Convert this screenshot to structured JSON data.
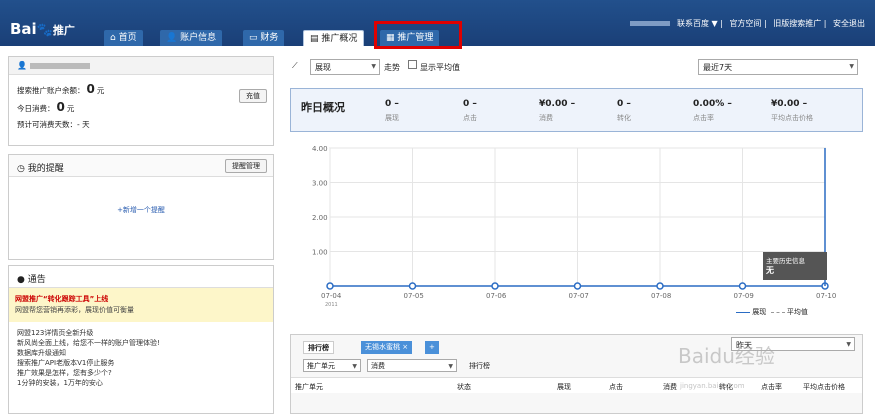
{
  "brand": {
    "logo": "Bai",
    "logo_suffix": "推广"
  },
  "nav": {
    "tabs": [
      {
        "label": "首页",
        "icon": "home-icon"
      },
      {
        "label": "账户信息",
        "icon": "user-icon"
      },
      {
        "label": "财务",
        "icon": "card-icon"
      },
      {
        "label": "推广概况",
        "icon": "chart-icon"
      },
      {
        "label": "推广管理",
        "icon": "grid-icon"
      }
    ],
    "links": [
      "联系百度 ▼",
      "官方空间",
      "旧版搜索推广",
      "安全退出"
    ]
  },
  "account": {
    "balance_label": "搜索推广账户余额：",
    "balance_value": "0",
    "balance_unit": "元",
    "today_label": "今日消费：",
    "today_value": "0",
    "today_unit": "元",
    "days_label": "预计可消费天数：",
    "days_value": "- 天",
    "recharge": "充值"
  },
  "reminders": {
    "title": "我的提醒",
    "manage": "提醒管理",
    "add": "+新增一个提醒"
  },
  "notice": {
    "title": "通告",
    "highlight_title": "网盟推广“转化跟踪工具”上线",
    "highlight_body": "网盟帮您营销再添彩，展现价值可衡量",
    "items": [
      "网盟123详情页全新升级",
      "新风尚全面上线，给您不一样的账户管理体验!",
      "数据库升级通知",
      "搜索推广API老版本V1停止服务",
      "推广效果是怎样，您有多少个?",
      "1分钟的安装，1万年的安心"
    ]
  },
  "toolbar": {
    "metric": "展现",
    "trend": "走势",
    "show_avg": "显示平均值",
    "range": "最近7天"
  },
  "overview": {
    "title": "昨日概况",
    "cells": [
      {
        "value": "0",
        "label": "展现"
      },
      {
        "value": "0",
        "label": "点击"
      },
      {
        "value": "¥0.00",
        "label": "消费"
      },
      {
        "value": "0",
        "label": "转化"
      },
      {
        "value": "0.00%",
        "label": "点击率"
      },
      {
        "value": "¥0.00",
        "label": "平均点击价格"
      }
    ]
  },
  "tooltip": {
    "title": "主要历史信息",
    "value": "无"
  },
  "chart_data": {
    "type": "line",
    "x": [
      "07-04",
      "07-05",
      "07-06",
      "07-07",
      "07-08",
      "07-09",
      "07-10"
    ],
    "x_sub": "2011",
    "ylim": [
      0,
      4
    ],
    "yticks": [
      "4.00",
      "3.00",
      "2.00",
      "1.00"
    ],
    "series": [
      {
        "name": "展现",
        "values": [
          0,
          0,
          0,
          0,
          0,
          0,
          0
        ]
      }
    ],
    "legend": [
      "展现",
      "平均值"
    ]
  },
  "ranking": {
    "tab1": "排行榜",
    "tab2": "无锡水蜜桃",
    "tab3": "+",
    "dim": "推广单元",
    "metric": "消费",
    "rank_label": "排行榜",
    "period": "昨天",
    "columns": [
      "推广单元",
      "状态",
      "展现",
      "点击",
      "消费",
      "转化",
      "点击率",
      "平均点击价格"
    ]
  },
  "watermark": {
    "main": "Baidu经验",
    "sub": "jingyan.baidu.com"
  }
}
